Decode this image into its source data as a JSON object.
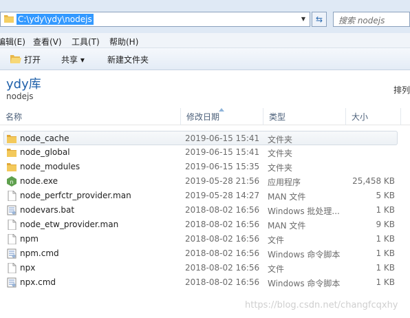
{
  "address": {
    "path": "C:\\ydy\\ydy\\nodejs",
    "search_placeholder": "搜索 nodejs"
  },
  "menu": [
    "编辑(E)",
    "查看(V)",
    "工具(T)",
    "帮助(H)"
  ],
  "toolbar": {
    "open": "打开",
    "share": "共享 ▾",
    "new_folder": "新建文件夹"
  },
  "library": {
    "title": "ydy库",
    "subtitle": "nodejs",
    "arrange": "排列"
  },
  "columns": {
    "name": "名称",
    "date": "修改日期",
    "type": "类型",
    "size": "大小"
  },
  "files": [
    {
      "name": "node_cache",
      "date": "2019-06-15 15:41",
      "type": "文件夹",
      "size": "",
      "icon": "folder-icon"
    },
    {
      "name": "node_global",
      "date": "2019-06-15 15:41",
      "type": "文件夹",
      "size": "",
      "icon": "folder-icon"
    },
    {
      "name": "node_modules",
      "date": "2019-06-15 15:35",
      "type": "文件夹",
      "size": "",
      "icon": "folder-icon"
    },
    {
      "name": "node.exe",
      "date": "2019-05-28 21:56",
      "type": "应用程序",
      "size": "25,458 KB",
      "icon": "nodejs-exe-icon"
    },
    {
      "name": "node_perfctr_provider.man",
      "date": "2019-05-28 14:27",
      "type": "MAN 文件",
      "size": "5 KB",
      "icon": "file-icon"
    },
    {
      "name": "nodevars.bat",
      "date": "2018-08-02 16:56",
      "type": "Windows 批处理...",
      "size": "1 KB",
      "icon": "script-icon"
    },
    {
      "name": "node_etw_provider.man",
      "date": "2018-08-02 16:56",
      "type": "MAN 文件",
      "size": "9 KB",
      "icon": "file-icon"
    },
    {
      "name": "npm",
      "date": "2018-08-02 16:56",
      "type": "文件",
      "size": "1 KB",
      "icon": "file-icon"
    },
    {
      "name": "npm.cmd",
      "date": "2018-08-02 16:56",
      "type": "Windows 命令脚本",
      "size": "1 KB",
      "icon": "script-icon"
    },
    {
      "name": "npx",
      "date": "2018-08-02 16:56",
      "type": "文件",
      "size": "1 KB",
      "icon": "file-icon"
    },
    {
      "name": "npx.cmd",
      "date": "2018-08-02 16:56",
      "type": "Windows 命令脚本",
      "size": "1 KB",
      "icon": "script-icon"
    }
  ],
  "watermark": "https://blog.csdn.net/changfcqxhy"
}
